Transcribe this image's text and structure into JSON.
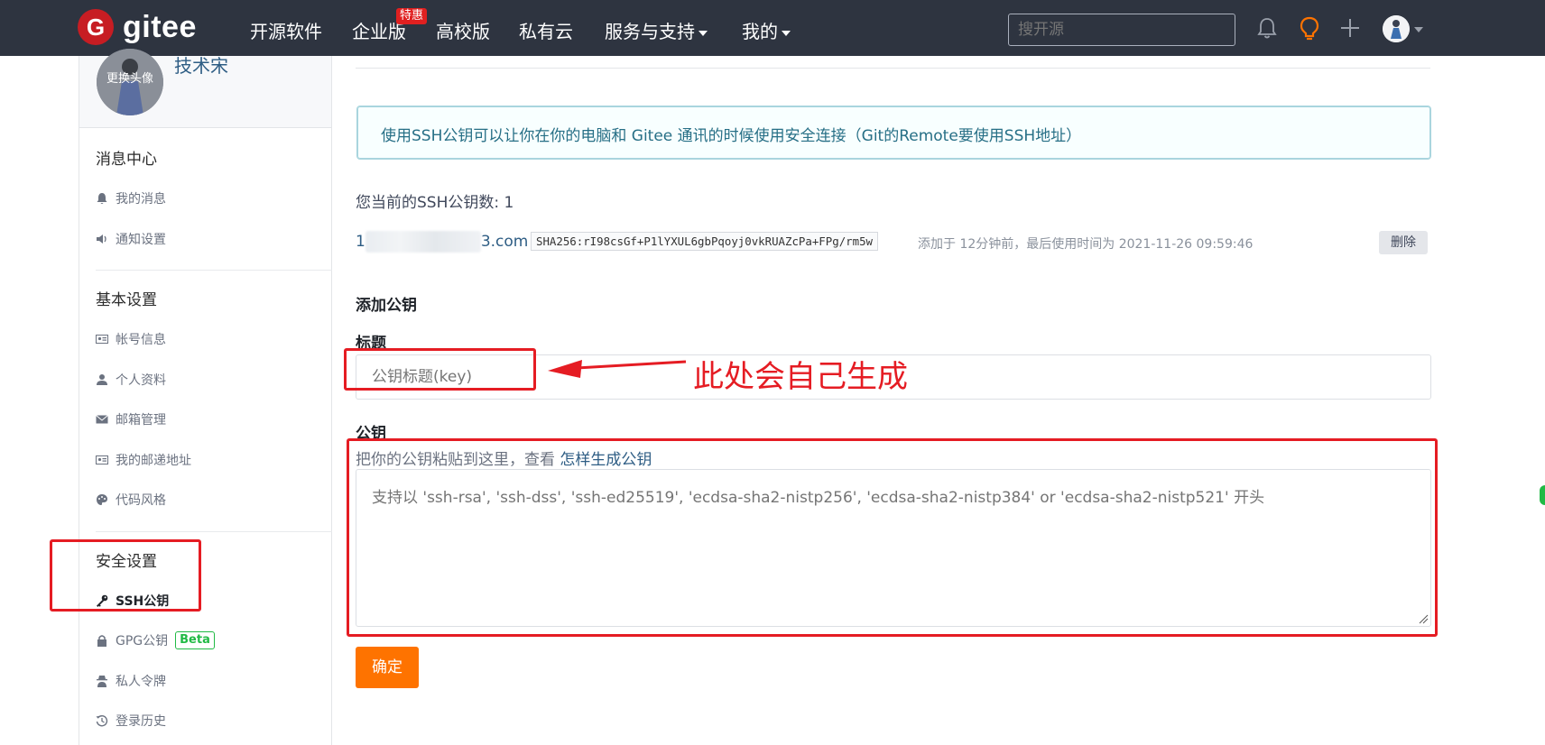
{
  "nav": {
    "logo_mark": "G",
    "logo_text": "gitee",
    "links": [
      "开源软件",
      "企业版",
      "高校版",
      "私有云",
      "服务与支持",
      "我的"
    ],
    "hot_badge": "特惠",
    "search_placeholder": "搜开源"
  },
  "sidebar": {
    "avatar_label": "更换头像",
    "username": "技术宋",
    "sections": {
      "messages": {
        "title": "消息中心",
        "items": [
          "我的消息",
          "通知设置"
        ]
      },
      "basic": {
        "title": "基本设置",
        "items": [
          "帐号信息",
          "个人资料",
          "邮箱管理",
          "我的邮递地址",
          "代码风格"
        ]
      },
      "security": {
        "title": "安全设置",
        "items": [
          "SSH公钥",
          "GPG公钥",
          "私人令牌",
          "登录历史"
        ],
        "beta": "Beta"
      }
    }
  },
  "main": {
    "info": "使用SSH公钥可以让你在你的电脑和 Gitee 通讯的时候使用安全连接（Git的Remote要使用SSH地址）",
    "key_count": "您当前的SSH公钥数: 1",
    "key": {
      "email_prefix": "1",
      "email_suffix": "3.com",
      "fingerprint": "SHA256:rI98csGf+P1lYXUL6gbPqoyj0vkRUAZcPa+FPg/rm5w",
      "meta": "添加于 12分钟前，最后使用时间为 2021-11-26 09:59:46",
      "delete": "删除"
    },
    "add_title": "添加公钥",
    "title_label": "标题",
    "title_placeholder": "公钥标题(key)",
    "key_label": "公钥",
    "hint_text": "把你的公钥粘贴到这里，查看 ",
    "hint_link": "怎样生成公钥",
    "key_placeholder": "支持以 'ssh-rsa', 'ssh-dss', 'ssh-ed25519', 'ecdsa-sha2-nistp256', 'ecdsa-sha2-nistp384' or 'ecdsa-sha2-nistp521' 开头",
    "submit": "确定"
  },
  "annotation": {
    "text": "此处会自己生成",
    "color": "#e51c23"
  },
  "colors": {
    "nav_bg": "#2e3440",
    "brand": "#c71d23",
    "submit": "#fe7300",
    "link": "#2e5d84"
  }
}
